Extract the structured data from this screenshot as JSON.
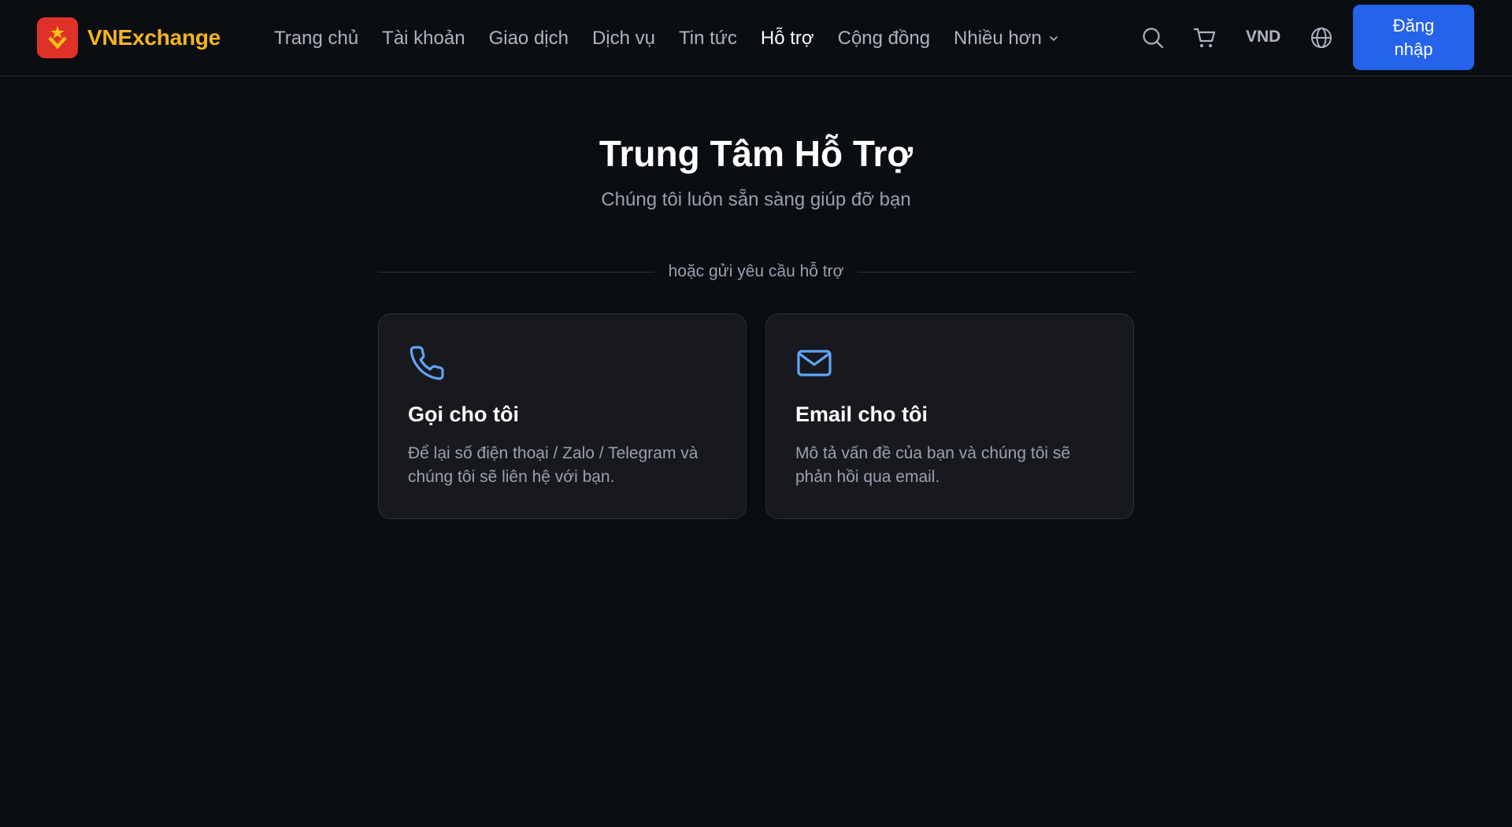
{
  "header": {
    "brand_name": "VNExchange",
    "nav_items": [
      {
        "label": "Trang chủ"
      },
      {
        "label": "Tài khoản"
      },
      {
        "label": "Giao dịch"
      },
      {
        "label": "Dịch vụ"
      },
      {
        "label": "Tin tức"
      },
      {
        "label": "Hỗ trợ",
        "active": true
      },
      {
        "label": "Cộng đồng"
      }
    ],
    "more_label": "Nhiều hơn",
    "currency": "VND",
    "login_label": "Đăng nhập"
  },
  "main": {
    "title": "Trung Tâm Hỗ Trợ",
    "subtitle": "Chúng tôi luôn sẵn sàng giúp đỡ bạn",
    "divider_text": "hoặc gửi yêu cầu hỗ trợ",
    "cards": [
      {
        "icon": "phone-icon",
        "title": "Gọi cho tôi",
        "description": "Để lại số điện thoại / Zalo / Telegram và chúng tôi sẽ liên hệ với bạn."
      },
      {
        "icon": "mail-icon",
        "title": "Email cho tôi",
        "description": "Mô tả vấn đề của bạn và chúng tôi sẽ phản hồi qua email."
      }
    ]
  },
  "colors": {
    "background": "#0a0d11",
    "brand": "#f6b51a",
    "logo_bg": "#e03128",
    "primary": "#2563eb",
    "icon_accent": "#60a5fa",
    "card_bg": "#17191e"
  },
  "icons": {
    "logo": "vn-star-chevron-logo",
    "search": "search-icon",
    "cart": "cart-icon",
    "language": "globe-icon",
    "more": "chevron-down-icon"
  }
}
